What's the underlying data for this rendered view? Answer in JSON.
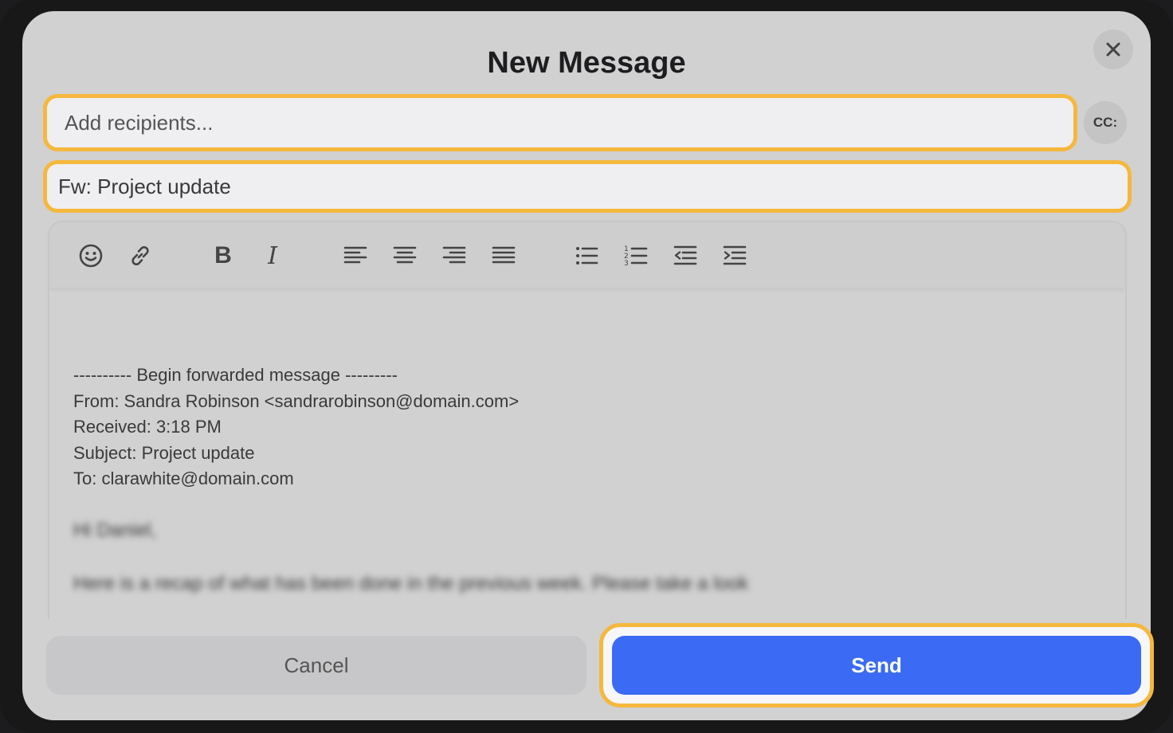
{
  "dialog": {
    "title": "New Message"
  },
  "fields": {
    "recipients_placeholder": "Add recipients...",
    "cc_label": "CC:",
    "subject_value": "Fw: Project update"
  },
  "toolbar": {
    "buttons": [
      {
        "icon": "emoji-icon"
      },
      {
        "icon": "link-icon"
      },
      {
        "icon": "bold-icon",
        "label": "B"
      },
      {
        "icon": "italic-icon",
        "label": "I"
      },
      {
        "icon": "align-left-icon"
      },
      {
        "icon": "align-center-icon"
      },
      {
        "icon": "align-right-icon"
      },
      {
        "icon": "align-justify-icon"
      },
      {
        "icon": "bullet-list-icon"
      },
      {
        "icon": "numbered-list-icon"
      },
      {
        "icon": "outdent-icon"
      },
      {
        "icon": "indent-icon"
      }
    ]
  },
  "body": {
    "forward_header": "---------- Begin forwarded message ---------",
    "from": "From: Sandra Robinson <sandrarobinson@domain.com>",
    "received": "Received: 3:18 PM",
    "subject": "Subject: Project update",
    "to": "To: clarawhite@domain.com",
    "greeting": "Hi Daniel,",
    "message": "Here is a recap of what has been done in the previous week. Please take a look"
  },
  "actions": {
    "cancel_label": "Cancel",
    "send_label": "Send"
  },
  "colors": {
    "accent": "#3b6bf5",
    "highlight": "#f5b83d"
  }
}
